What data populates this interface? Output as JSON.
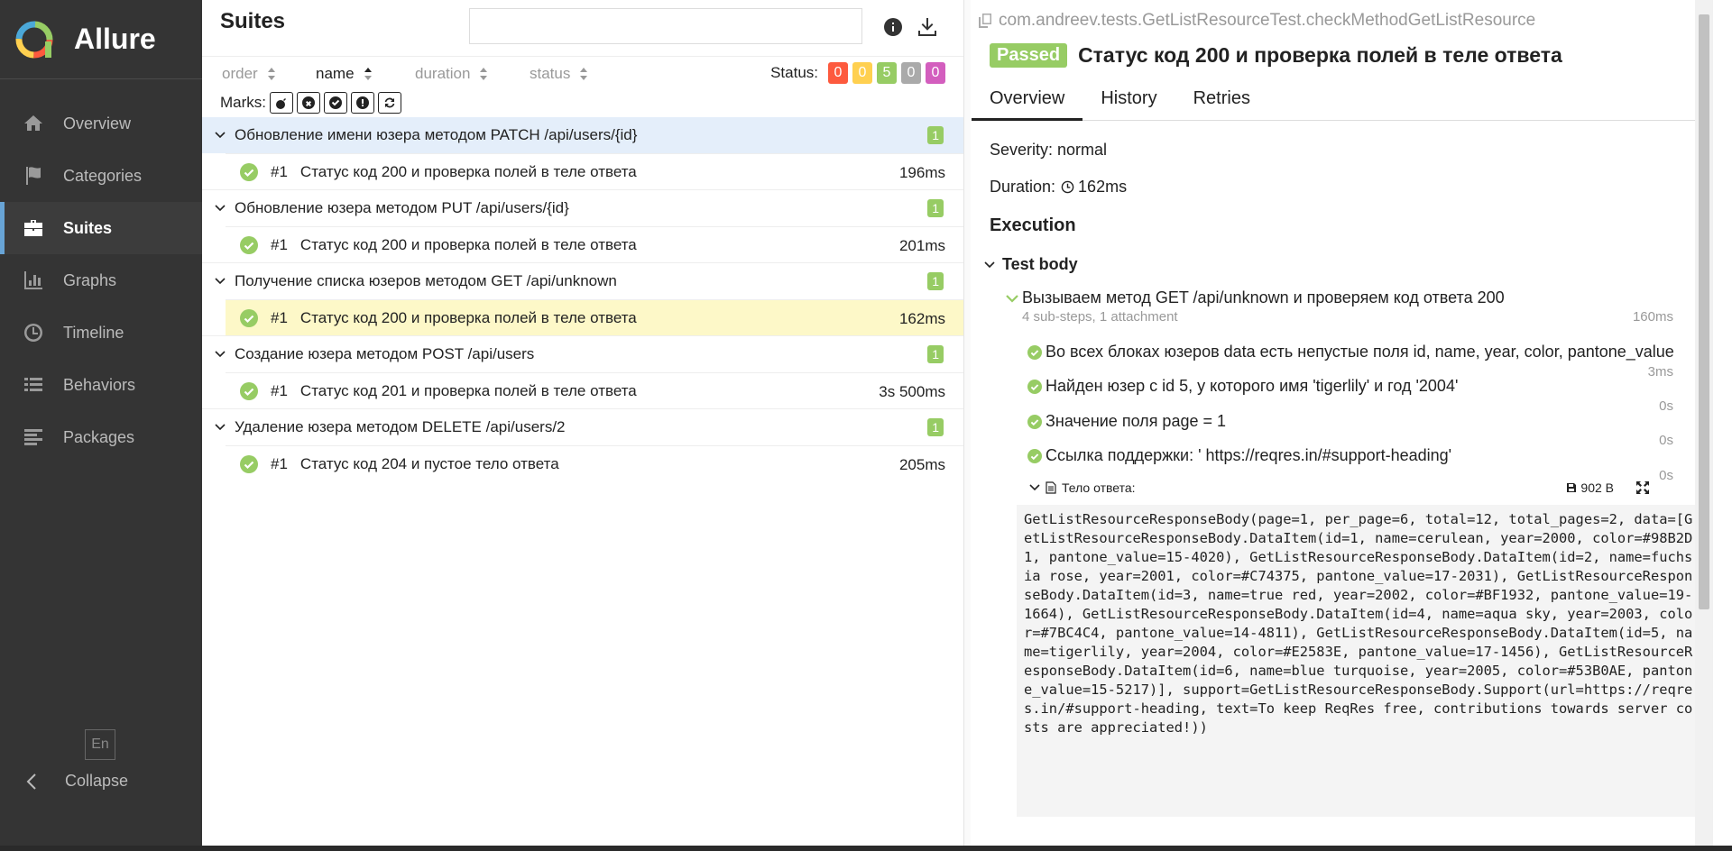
{
  "app": {
    "name": "Allure",
    "lang": "En",
    "collapse_label": "Collapse"
  },
  "nav": [
    {
      "label": "Overview",
      "icon": "home-icon",
      "active": false
    },
    {
      "label": "Categories",
      "icon": "flag-icon",
      "active": false
    },
    {
      "label": "Suites",
      "icon": "briefcase-icon",
      "active": true
    },
    {
      "label": "Graphs",
      "icon": "bar-chart-icon",
      "active": false
    },
    {
      "label": "Timeline",
      "icon": "clock-icon",
      "active": false
    },
    {
      "label": "Behaviors",
      "icon": "list-icon",
      "active": false
    },
    {
      "label": "Packages",
      "icon": "align-left-icon",
      "active": false
    }
  ],
  "suites": {
    "title": "Suites",
    "search_value": "",
    "sort": [
      "order",
      "name",
      "duration",
      "status"
    ],
    "active_sort": "name",
    "status_label": "Status:",
    "status_counts": [
      {
        "value": "0",
        "color": "#fd5a3e"
      },
      {
        "value": "0",
        "color": "#ffd050"
      },
      {
        "value": "5",
        "color": "#97cc64"
      },
      {
        "value": "0",
        "color": "#aaaaaa"
      },
      {
        "value": "0",
        "color": "#d35ebe"
      }
    ],
    "marks_label": "Marks:",
    "groups": [
      {
        "name": "Обновление имени юзера методом PATCH /api/users/{id}",
        "count": "1",
        "highlight": true,
        "tests": [
          {
            "num": "#1",
            "name": "Статус код 200 и проверка полей в теле ответа",
            "duration": "196ms",
            "selected": false
          }
        ]
      },
      {
        "name": "Обновление юзера методом PUT /api/users/{id}",
        "count": "1",
        "highlight": false,
        "tests": [
          {
            "num": "#1",
            "name": "Статус код 200 и проверка полей в теле ответа",
            "duration": "201ms",
            "selected": false
          }
        ]
      },
      {
        "name": "Получение списка юзеров методом GET /api/unknown",
        "count": "1",
        "highlight": false,
        "tests": [
          {
            "num": "#1",
            "name": "Статус код 200 и проверка полей в теле ответа",
            "duration": "162ms",
            "selected": true
          }
        ]
      },
      {
        "name": "Создание юзера методом POST /api/users",
        "count": "1",
        "highlight": false,
        "tests": [
          {
            "num": "#1",
            "name": "Статус код 201 и проверка полей в теле ответа",
            "duration": "3s 500ms",
            "selected": false
          }
        ]
      },
      {
        "name": "Удаление юзера методом DELETE /api/users/2",
        "count": "1",
        "highlight": false,
        "tests": [
          {
            "num": "#1",
            "name": "Статус код 204 и пустое тело ответа",
            "duration": "205ms",
            "selected": false
          }
        ]
      }
    ]
  },
  "details": {
    "path": "com.andreev.tests.GetListResourceTest.checkMethodGetListResource",
    "status": "Passed",
    "title": "Статус код 200 и проверка полей в теле ответа",
    "tabs": [
      "Overview",
      "History",
      "Retries"
    ],
    "severity": "Severity: normal",
    "duration_label": "Duration:",
    "duration": "162ms",
    "execution": "Execution",
    "test_body": "Test body",
    "step": {
      "name": "Вызываем метод GET /api/unknown и проверяем код ответа 200",
      "info": "4 sub-steps, 1 attachment",
      "duration": "160ms"
    },
    "sub_steps": [
      {
        "name": "Во всех блоках юзеров data есть непустые поля id, name, year, color, pantone_value",
        "duration": "3ms"
      },
      {
        "name": "Найден юзер с id 5, у которого имя 'tigerlily' и год '2004'",
        "duration": "0s"
      },
      {
        "name": "Значение поля page = 1",
        "duration": "0s"
      },
      {
        "name": "Ссылка поддержки: ' https://reqres.in/#support-heading'",
        "duration": "0s"
      }
    ],
    "attachment": {
      "name": "Тело ответа:",
      "size": "902 B"
    },
    "code": "GetListResourceResponseBody(page=1, per_page=6, total=12, total_pages=2, data=[GetListResourceResponseBody.DataItem(id=1, name=cerulean, year=2000, color=#98B2D1, pantone_value=15-4020), GetListResourceResponseBody.DataItem(id=2, name=fuchsia rose, year=2001, color=#C74375, pantone_value=17-2031), GetListResourceResponseBody.DataItem(id=3, name=true red, year=2002, color=#BF1932, pantone_value=19-1664), GetListResourceResponseBody.DataItem(id=4, name=aqua sky, year=2003, color=#7BC4C4, pantone_value=14-4811), GetListResourceResponseBody.DataItem(id=5, name=tigerlily, year=2004, color=#E2583E, pantone_value=17-1456), GetListResourceResponseBody.DataItem(id=6, name=blue turquoise, year=2005, color=#53B0AE, pantone_value=15-5217)], support=GetListResourceResponseBody.Support(url=https://reqres.in/#support-heading, text=To keep ReqRes free, contributions towards server costs are appreciated!))"
  }
}
